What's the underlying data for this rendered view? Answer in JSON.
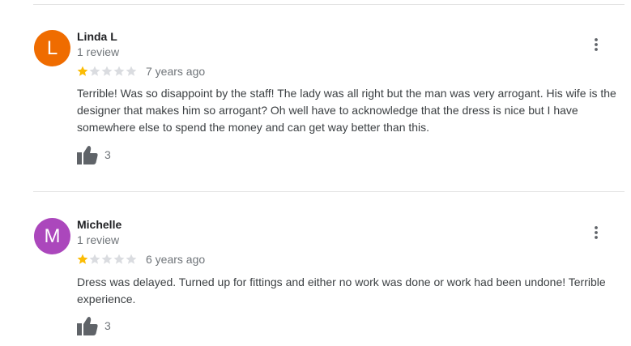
{
  "reviews": [
    {
      "initial": "L",
      "avatar_color": "#ef6c00",
      "name": "Linda L",
      "review_count": "1 review",
      "rating": 1,
      "time": "7 years ago",
      "text": "Terrible! Was so disappoint by the staff! The lady was all right but the man was very arrogant. His wife is the designer that makes him so arrogant? Oh well have to acknowledge that the dress is nice but I have somewhere else to spend the money and can get way better than this.",
      "likes": "3"
    },
    {
      "initial": "M",
      "avatar_color": "#ab47bc",
      "name": "Michelle",
      "review_count": "1 review",
      "rating": 1,
      "time": "6 years ago",
      "text": "Dress was delayed. Turned up for fittings and either no work was done or work had been undone! Terrible experience.",
      "likes": "3"
    }
  ],
  "colors": {
    "star_filled": "#fbbc04",
    "star_empty": "#dadce0",
    "icon": "#5f6368"
  },
  "icons": {
    "like": "thumbs-up-icon",
    "menu": "more-vertical-icon",
    "star": "star-icon"
  }
}
